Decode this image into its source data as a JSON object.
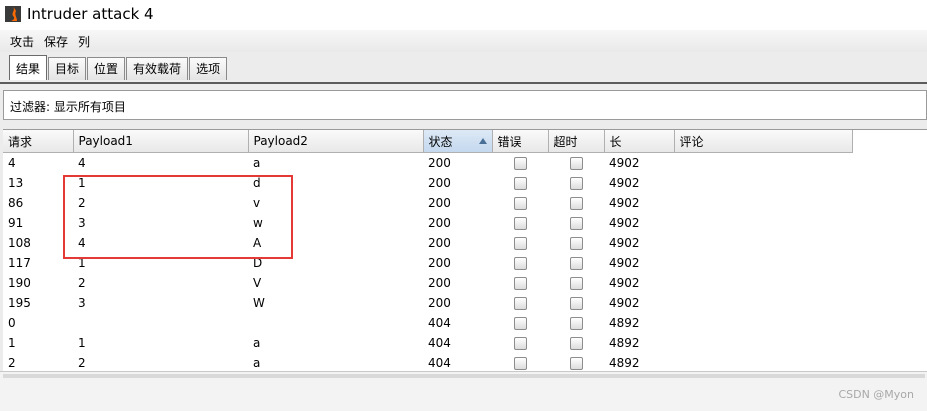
{
  "window": {
    "title": "Intruder attack 4"
  },
  "menu": [
    "攻击",
    "保存",
    "列"
  ],
  "tabs": [
    {
      "label": "结果",
      "active": true
    },
    {
      "label": "目标",
      "active": false
    },
    {
      "label": "位置",
      "active": false
    },
    {
      "label": "有效载荷",
      "active": false
    },
    {
      "label": "选项",
      "active": false
    }
  ],
  "filter": {
    "text": "过滤器:  显示所有项目"
  },
  "table": {
    "columns": [
      "请求",
      "Payload1",
      "Payload2",
      "状态",
      "错误",
      "超时",
      "长",
      "评论"
    ],
    "sorted_column": "状态",
    "rows": [
      {
        "request": "4",
        "payload1": "4",
        "payload2": "a",
        "status": "200",
        "error": false,
        "timeout": false,
        "length": "4902",
        "comment": ""
      },
      {
        "request": "13",
        "payload1": "1",
        "payload2": "d",
        "status": "200",
        "error": false,
        "timeout": false,
        "length": "4902",
        "comment": ""
      },
      {
        "request": "86",
        "payload1": "2",
        "payload2": "v",
        "status": "200",
        "error": false,
        "timeout": false,
        "length": "4902",
        "comment": ""
      },
      {
        "request": "91",
        "payload1": "3",
        "payload2": "w",
        "status": "200",
        "error": false,
        "timeout": false,
        "length": "4902",
        "comment": ""
      },
      {
        "request": "108",
        "payload1": "4",
        "payload2": "A",
        "status": "200",
        "error": false,
        "timeout": false,
        "length": "4902",
        "comment": ""
      },
      {
        "request": "117",
        "payload1": "1",
        "payload2": "D",
        "status": "200",
        "error": false,
        "timeout": false,
        "length": "4902",
        "comment": ""
      },
      {
        "request": "190",
        "payload1": "2",
        "payload2": "V",
        "status": "200",
        "error": false,
        "timeout": false,
        "length": "4902",
        "comment": ""
      },
      {
        "request": "195",
        "payload1": "3",
        "payload2": "W",
        "status": "200",
        "error": false,
        "timeout": false,
        "length": "4902",
        "comment": ""
      },
      {
        "request": "0",
        "payload1": "",
        "payload2": "",
        "status": "404",
        "error": false,
        "timeout": false,
        "length": "4892",
        "comment": ""
      },
      {
        "request": "1",
        "payload1": "1",
        "payload2": "a",
        "status": "404",
        "error": false,
        "timeout": false,
        "length": "4892",
        "comment": ""
      },
      {
        "request": "2",
        "payload1": "2",
        "payload2": "a",
        "status": "404",
        "error": false,
        "timeout": false,
        "length": "4892",
        "comment": ""
      }
    ]
  },
  "watermark": "CSDN @Myon⁠"
}
